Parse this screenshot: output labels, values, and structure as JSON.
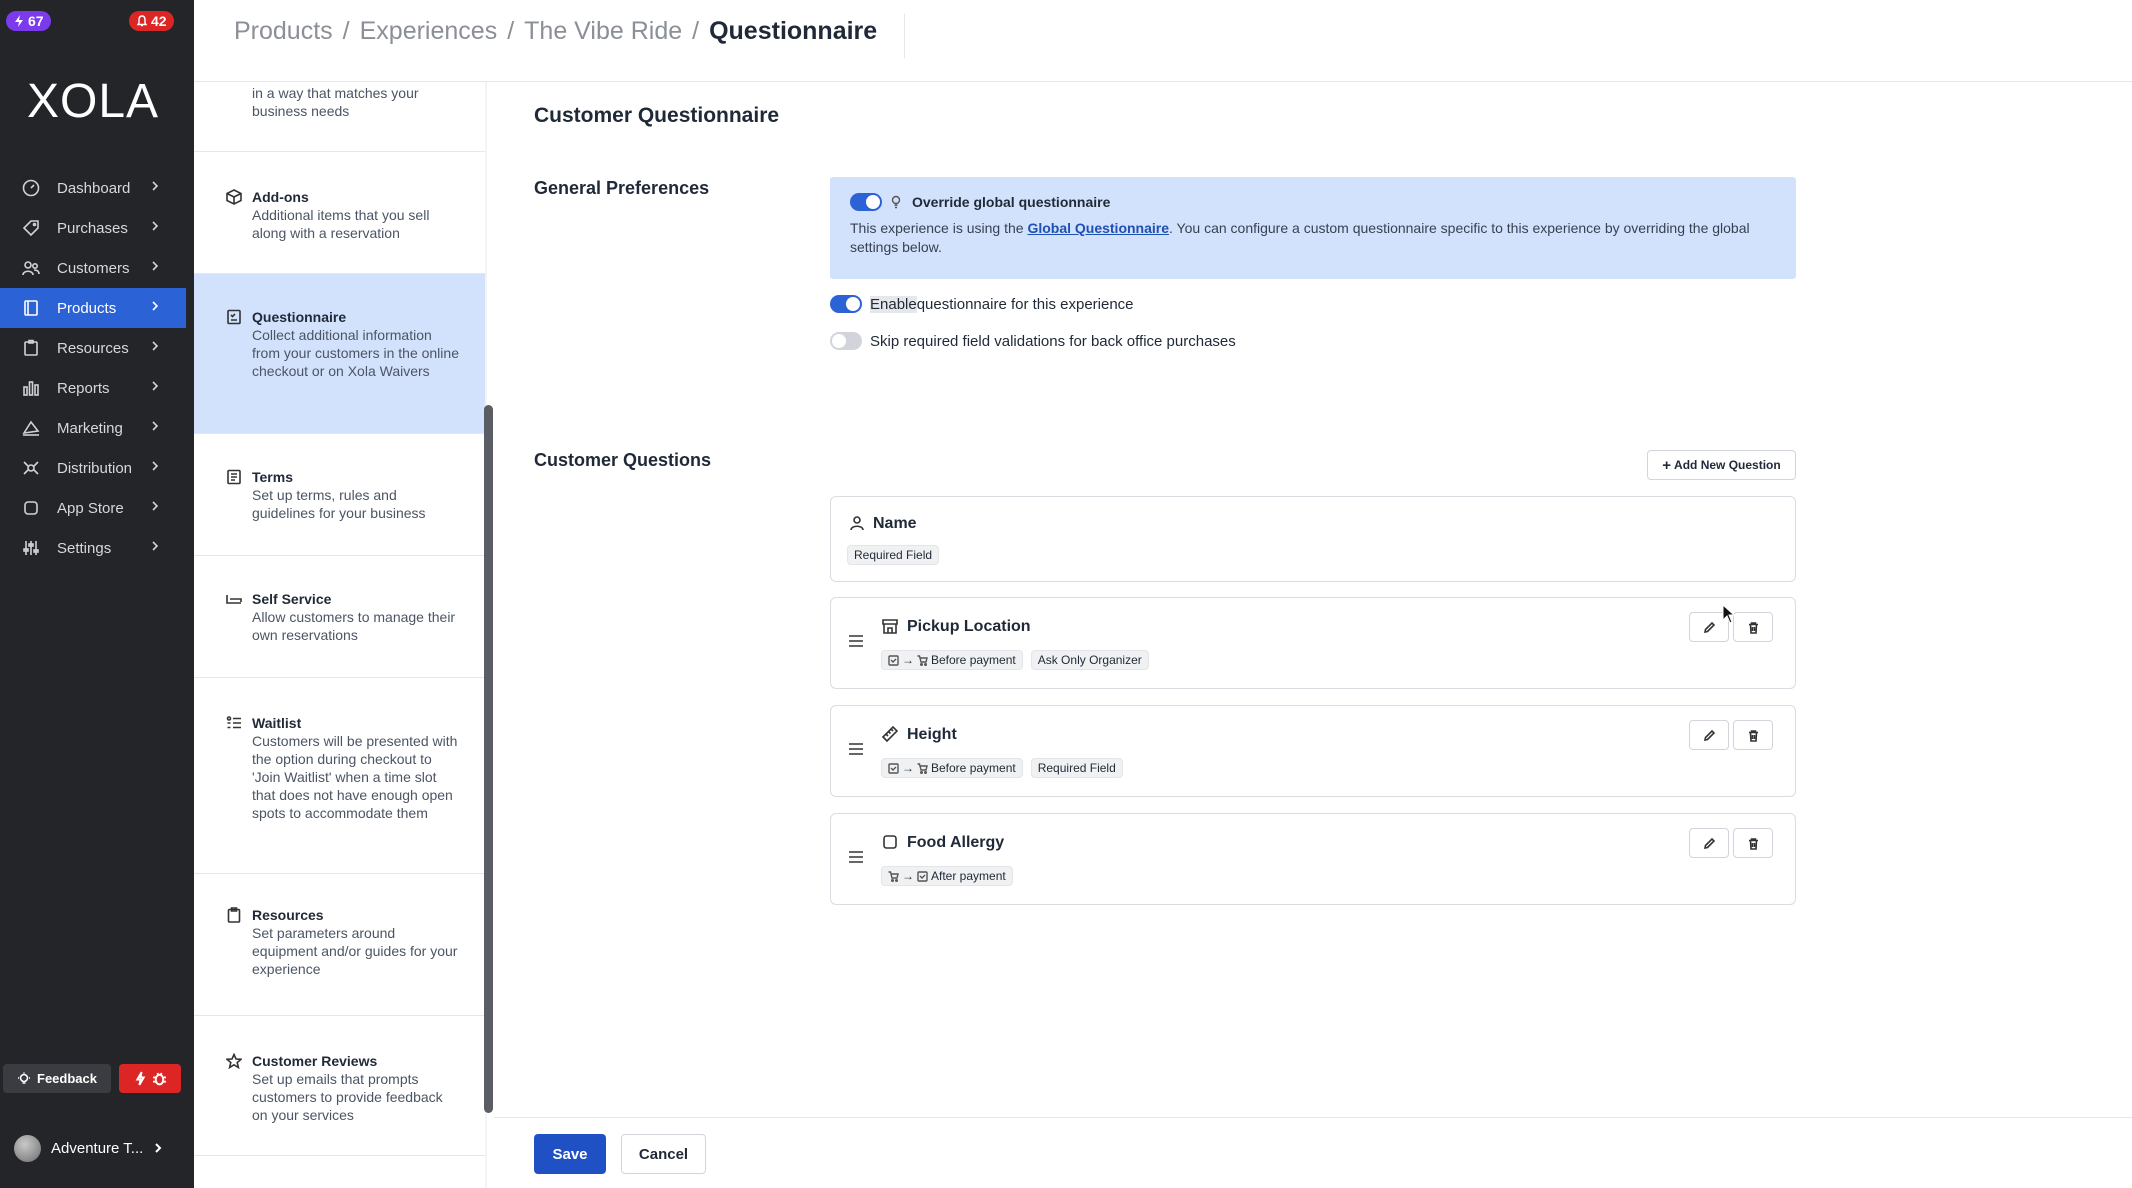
{
  "badges": {
    "left_count": "67",
    "right_count": "42"
  },
  "brand": {
    "logo_text": "XOLA"
  },
  "nav": {
    "items": [
      {
        "label": "Dashboard",
        "icon": "dashboard-icon"
      },
      {
        "label": "Purchases",
        "icon": "purchases-icon"
      },
      {
        "label": "Customers",
        "icon": "customers-icon"
      },
      {
        "label": "Products",
        "icon": "products-icon",
        "active": true
      },
      {
        "label": "Resources",
        "icon": "resources-icon"
      },
      {
        "label": "Reports",
        "icon": "reports-icon"
      },
      {
        "label": "Marketing",
        "icon": "marketing-icon"
      },
      {
        "label": "Distribution",
        "icon": "distribution-icon"
      },
      {
        "label": "App Store",
        "icon": "app-store-icon"
      },
      {
        "label": "Settings",
        "icon": "settings-icon"
      }
    ],
    "feedback_label": "Feedback",
    "account_name": "Adventure T..."
  },
  "breadcrumb": {
    "items": [
      "Products",
      "Experiences",
      "The Vibe Ride"
    ],
    "current": "Questionnaire",
    "separator": "/"
  },
  "subnav": {
    "partial_desc": "in a way that matches your business needs",
    "items": [
      {
        "title": "Add-ons",
        "desc": "Additional items that you sell along with a reservation"
      },
      {
        "title": "Questionnaire",
        "desc": "Collect additional information from your customers in the online checkout or on Xola Waivers",
        "active": true
      },
      {
        "title": "Terms",
        "desc": "Set up terms, rules and guidelines for your business"
      },
      {
        "title": "Self Service",
        "desc": "Allow customers to manage their own reservations"
      },
      {
        "title": "Waitlist",
        "desc": "Customers will be presented with the option during checkout to 'Join Waitlist' when a time slot that does not have enough open spots to accommodate them"
      },
      {
        "title": "Resources",
        "desc": "Set parameters around equipment and/or guides for your experience"
      },
      {
        "title": "Customer Reviews",
        "desc": "Set up emails that prompts customers to provide feedback on your services"
      }
    ]
  },
  "main": {
    "title": "Customer Questionnaire",
    "general_preferences": {
      "label": "General Preferences",
      "override": {
        "label": "Override global questionnaire",
        "text_before": "This experience is using the ",
        "link": "Global Questionnaire",
        "text_after": ". You can configure a custom questionnaire specific to this experience by overriding the global settings below."
      },
      "enable_highlight": "Enable",
      "enable_rest": " questionnaire for this experience",
      "skip_label": "Skip required field validations for back office purchases"
    },
    "customer_questions": {
      "label": "Customer Questions",
      "add_button": "Add New Question",
      "questions": [
        {
          "title": "Name",
          "icon": "person-icon",
          "tags": [
            "Required Field"
          ]
        },
        {
          "title": "Pickup Location",
          "icon": "store-icon",
          "timing": "Before payment",
          "tags": [
            "Ask Only Organizer"
          ]
        },
        {
          "title": "Height",
          "icon": "ruler-icon",
          "timing": "Before payment",
          "tags": [
            "Required Field"
          ]
        },
        {
          "title": "Food Allergy",
          "icon": "checkbox-icon",
          "timing": "After payment",
          "tags": []
        }
      ]
    }
  },
  "footer": {
    "save_label": "Save",
    "cancel_label": "Cancel"
  },
  "colors": {
    "accent": "#2b62d6",
    "sidebar_bg": "#232529",
    "highlight_bg": "#d3e2fc",
    "danger": "#dc2626",
    "badge_purple": "#7c3aed"
  }
}
